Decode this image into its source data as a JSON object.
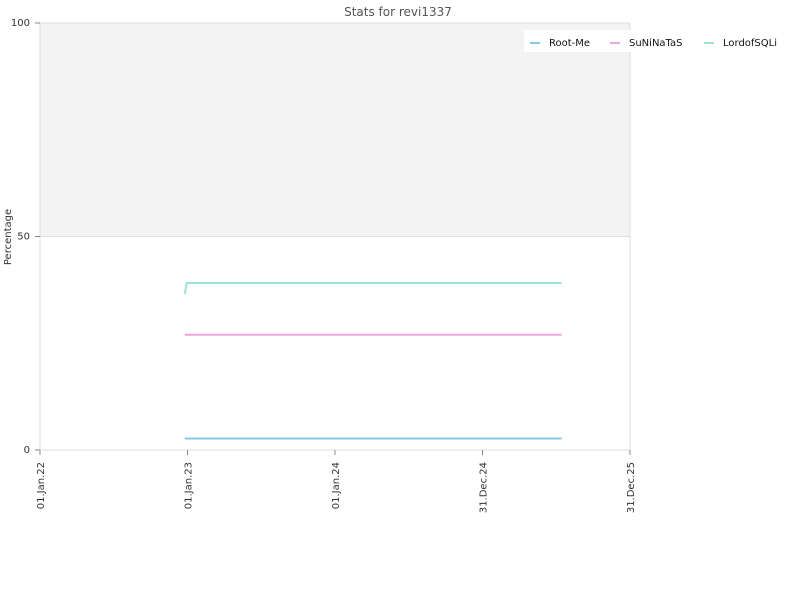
{
  "chart_data": {
    "type": "line",
    "title": "Stats for revi1337",
    "ylabel": "Percentage",
    "xlabel": "",
    "ylim": [
      0,
      100
    ],
    "yticks": [
      0,
      50,
      100
    ],
    "xlim": [
      "2022-01-01",
      "2025-12-31"
    ],
    "xticks": [
      {
        "date": "2022-01-01",
        "label": "01.Jan.22"
      },
      {
        "date": "2023-01-01",
        "label": "01.Jan.23"
      },
      {
        "date": "2024-01-01",
        "label": "01.Jan.24"
      },
      {
        "date": "2024-12-31",
        "label": "31.Dec.24"
      },
      {
        "date": "2025-12-31",
        "label": "31.Dec.25"
      }
    ],
    "shaded_band": {
      "from": 50,
      "to": 100,
      "color": "#f3f3f3"
    },
    "legend_position": "top-right",
    "series": [
      {
        "name": "Root-Me",
        "color": "#86c8ee",
        "points": [
          [
            "2022-12-25",
            2.7
          ],
          [
            "2025-07-15",
            2.7
          ]
        ]
      },
      {
        "name": "SuNiNaTaS",
        "color": "#f0a6d4",
        "points": [
          [
            "2022-12-25",
            27
          ],
          [
            "2025-07-15",
            27
          ]
        ]
      },
      {
        "name": "LordofSQLi",
        "color": "#9ee3d8",
        "points": [
          [
            "2022-12-25",
            36.5
          ],
          [
            "2022-12-30",
            39.1
          ],
          [
            "2025-07-15",
            39.1
          ]
        ]
      }
    ]
  }
}
